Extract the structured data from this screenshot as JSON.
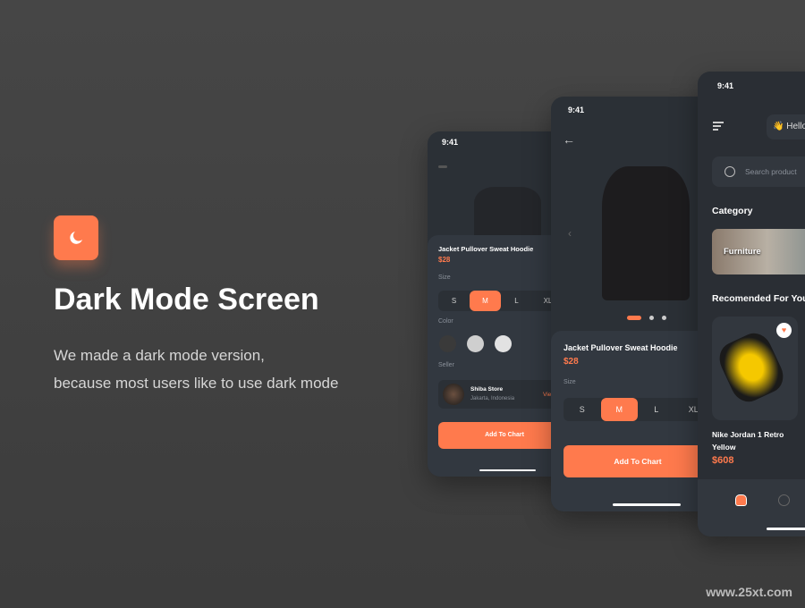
{
  "hero": {
    "icon": "moon-icon",
    "title": "Dark Mode Screen",
    "subtitle_line1": "We made a dark mode version,",
    "subtitle_line2": "because most users like to use dark mode"
  },
  "colors": {
    "accent": "#ff7a4d",
    "background": "#404040",
    "phone": "#2b3036"
  },
  "phone_back": {
    "time": "9:41",
    "product": "Jacket Pullover Sweat Hoodie",
    "price": "$28",
    "size_label": "Size",
    "sizes": [
      "S",
      "M",
      "L",
      "XL"
    ],
    "selected_size": "M",
    "color_label": "Color",
    "colors": [
      "#3a3a3a",
      "#cfcfcf",
      "#e2e2e2"
    ],
    "seller_label": "Seller",
    "seller_name": "Shiba Store",
    "seller_location": "Jakarta, Indonesia",
    "seller_link": "View",
    "button": "Add To Chart"
  },
  "phone_mid": {
    "time": "9:41",
    "product": "Jacket Pullover Sweat Hoodie",
    "price": "$28",
    "size_label": "Size",
    "sizes": [
      "S",
      "M",
      "L",
      "XL"
    ],
    "selected_size": "M",
    "button": "Add To Chart",
    "carousel": {
      "pages": 3,
      "active": 1
    }
  },
  "phone_front": {
    "time": "9:41",
    "greeting": "👋 Hello",
    "search_placeholder": "Search product",
    "category_title": "Category",
    "category": "Furniture",
    "recommended_title": "Recomended For You",
    "product_name_line1": "Nike Jordan 1 Retro",
    "product_name_line2": "Yellow",
    "product_price": "$608"
  },
  "watermark": "www.25xt.com"
}
